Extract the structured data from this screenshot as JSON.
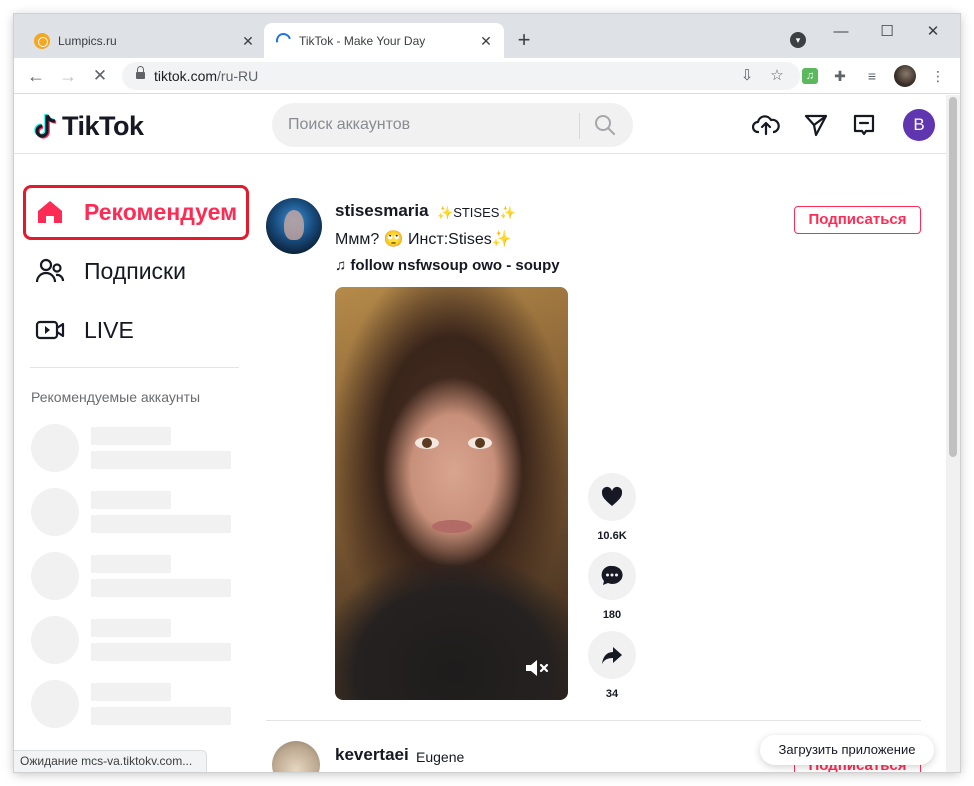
{
  "browser": {
    "tabs": [
      {
        "title": "Lumpics.ru",
        "close": "✕"
      },
      {
        "title": "TikTok - Make Your Day",
        "close": "✕"
      }
    ],
    "new_tab": "+",
    "window_controls": {
      "minimize": "—",
      "maximize": "☐",
      "close": "✕"
    },
    "url": {
      "host": "tiktok.com",
      "path": "/ru-RU"
    },
    "status": "Ожидание mcs-va.tiktokv.com..."
  },
  "tiktok": {
    "logo": "TikTok",
    "search_placeholder": "Поиск аккаунтов",
    "avatar_letter": "B"
  },
  "sidebar": {
    "items": [
      {
        "label": "Рекомендуем",
        "icon": "home-icon",
        "active": true
      },
      {
        "label": "Подписки",
        "icon": "people-icon",
        "active": false
      },
      {
        "label": "LIVE",
        "icon": "live-icon",
        "active": false
      }
    ],
    "suggested_caption": "Рекомендуемые аккаунты"
  },
  "feed": {
    "posts": [
      {
        "username": "stisesmaria",
        "nickname": "STISES",
        "caption": "Ммм? 🙄 Инст:Stises✨",
        "music": "follow nsfwsoup owo - soupy",
        "follow_label": "Подписаться",
        "likes": "10.6K",
        "comments": "180",
        "shares": "34"
      },
      {
        "username": "kevertaei",
        "nickname": "Eugene",
        "follow_label": "Подписаться"
      }
    ],
    "get_app_label": "Загрузить приложение"
  },
  "colors": {
    "accent": "#fe2c55",
    "highlight_box": "#e3192c",
    "avatar_bg": "#6035b0"
  }
}
